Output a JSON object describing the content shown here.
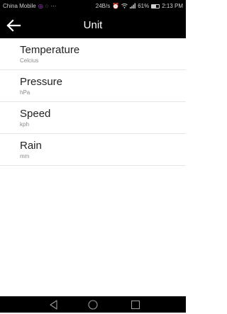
{
  "status_bar": {
    "carrier": "China Mobile",
    "dots": "···",
    "net_speed": "24B/s",
    "battery_percent": "61%",
    "time": "2:13 PM",
    "battery_level": 0.61
  },
  "toolbar": {
    "title": "Unit"
  },
  "units": [
    {
      "label": "Temperature",
      "value": "Celcius"
    },
    {
      "label": "Pressure",
      "value": "hPa"
    },
    {
      "label": "Speed",
      "value": "kph"
    },
    {
      "label": "Rain",
      "value": "mm"
    }
  ],
  "colors": {
    "bar_background": "#000000",
    "divider": "#e6e6e6",
    "title_text": "#222222",
    "subtitle_text": "#8a8a8a"
  },
  "icons": {
    "back": "arrow-left-icon",
    "nav_back": "triangle-back-icon",
    "nav_home": "circle-home-icon",
    "nav_recent": "square-recent-icon"
  }
}
